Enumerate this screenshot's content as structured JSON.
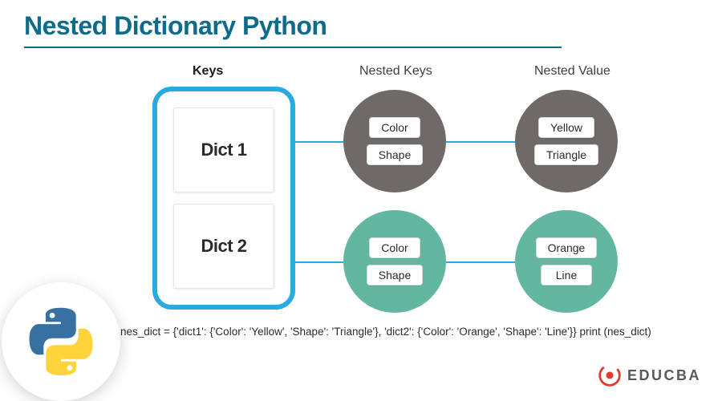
{
  "title": "Nested Dictionary Python",
  "col_headers": {
    "keys": "Keys",
    "nested_keys": "Nested Keys",
    "nested_value": "Nested Value"
  },
  "keys": {
    "dict1": "Dict 1",
    "dict2": "Dict 2"
  },
  "row1": {
    "nested_keys": [
      "Color",
      "Shape"
    ],
    "nested_values": [
      "Yellow",
      "Triangle"
    ]
  },
  "row2": {
    "nested_keys": [
      "Color",
      "Shape"
    ],
    "nested_values": [
      "Orange",
      "Line"
    ]
  },
  "code": "nes_dict = {'dict1': {'Color': 'Yellow', 'Shape': 'Triangle'}, 'dict2': {'Color': 'Orange', 'Shape': 'Line'}} print (nes_dict)",
  "brand": "EDUCBA",
  "colors": {
    "accent_blue": "#29abe2",
    "title_teal": "#0e6b8a",
    "circle_gray": "#6f6a68",
    "circle_green": "#63b7a0"
  },
  "chart_data": {
    "type": "table",
    "title": "Nested Dictionary Python",
    "columns": [
      "Keys",
      "Nested Keys",
      "Nested Value"
    ],
    "rows": [
      {
        "key": "Dict 1",
        "nested_keys": [
          "Color",
          "Shape"
        ],
        "nested_values": [
          "Yellow",
          "Triangle"
        ]
      },
      {
        "key": "Dict 2",
        "nested_keys": [
          "Color",
          "Shape"
        ],
        "nested_values": [
          "Orange",
          "Line"
        ]
      }
    ],
    "annotations": [
      "nes_dict = {'dict1': {'Color': 'Yellow', 'Shape': 'Triangle'}, 'dict2': {'Color': 'Orange', 'Shape': 'Line'}} print (nes_dict)"
    ]
  }
}
